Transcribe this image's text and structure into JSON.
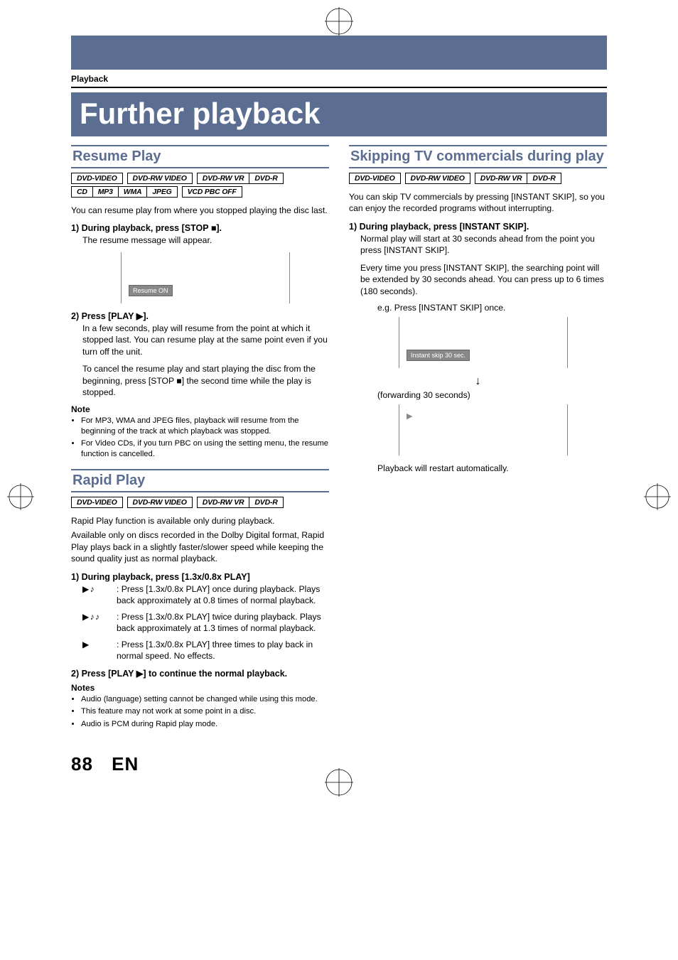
{
  "breadcrumb": "Playback",
  "page_title": "Further playback",
  "footer": {
    "page": "88",
    "lang": "EN"
  },
  "sections": {
    "resume": {
      "title": "Resume Play",
      "tags": [
        "DVD-VIDEO",
        "DVD-RW VIDEO",
        "DVD-RW VR",
        "DVD-R",
        "CD",
        "MP3",
        "WMA",
        "JPEG",
        "VCD PBC OFF"
      ],
      "intro": "You can resume play from where you stopped playing the disc last.",
      "step1_title": "1) During playback, press [STOP ■].",
      "step1_sub": "The resume message will appear.",
      "osd_chip": "Resume ON",
      "step2_title": "2) Press [PLAY ▶].",
      "step2_sub_a": "In a few seconds, play will resume from the point at which it stopped last. You can resume play at the same point even if you turn off the unit.",
      "step2_sub_b": "To cancel the resume play and start playing the disc from the beginning, press [STOP ■] the second time while the play is stopped.",
      "note_h": "Note",
      "notes": [
        "For MP3, WMA and JPEG files, playback will resume from the beginning of the track at which playback was stopped.",
        "For Video CDs, if you turn PBC on using the setting menu, the resume function is cancelled."
      ]
    },
    "rapid": {
      "title": "Rapid Play",
      "tags": [
        "DVD-VIDEO",
        "DVD-RW VIDEO",
        "DVD-RW VR",
        "DVD-R"
      ],
      "intro_a": "Rapid Play function is available only during playback.",
      "intro_b": "Available only on discs recorded in the Dolby Digital format, Rapid Play plays back in a slightly faster/slower speed while keeping the sound quality just as normal playback.",
      "step1_title": "1) During playback, press [1.3x/0.8x PLAY]",
      "rows": [
        {
          "sym": "▶ ♪",
          "text": ": Press [1.3x/0.8x PLAY] once during playback. Plays back approximately at 0.8 times of normal playback."
        },
        {
          "sym": "▶ ♪ ♪",
          "text": ": Press [1.3x/0.8x PLAY] twice during playback. Plays back approximately at 1.3 times of normal playback."
        },
        {
          "sym": "▶",
          "text": ": Press [1.3x/0.8x PLAY] three times to play back in normal speed. No effects."
        }
      ],
      "step2_title": "2) Press [PLAY ▶] to continue the normal playback.",
      "notes_h": "Notes",
      "notes": [
        "Audio (language) setting cannot be changed while using this mode.",
        "This feature may not work at some point in a disc.",
        "Audio is PCM during Rapid play mode."
      ]
    },
    "skip": {
      "title": "Skipping TV commercials during play",
      "tags": [
        "DVD-VIDEO",
        "DVD-RW VIDEO",
        "DVD-RW VR",
        "DVD-R"
      ],
      "intro": "You can skip TV commercials by pressing [INSTANT SKIP], so you can enjoy the recorded programs without interrupting.",
      "step1_title": "1) During playback, press [INSTANT SKIP].",
      "step1_sub_a": "Normal play will start at 30 seconds ahead from the point you press [INSTANT SKIP].",
      "step1_sub_b": "Every time you press [INSTANT SKIP], the searching point will be extended by 30 seconds ahead. You can press up to 6 times (180 seconds).",
      "eg_label": "e.g. Press [INSTANT SKIP] once.",
      "osd_chip": "Instant skip  30 sec.",
      "fwd_label": "(forwarding 30 seconds)",
      "osd_play": "▶",
      "outro": "Playback will restart automatically."
    }
  }
}
